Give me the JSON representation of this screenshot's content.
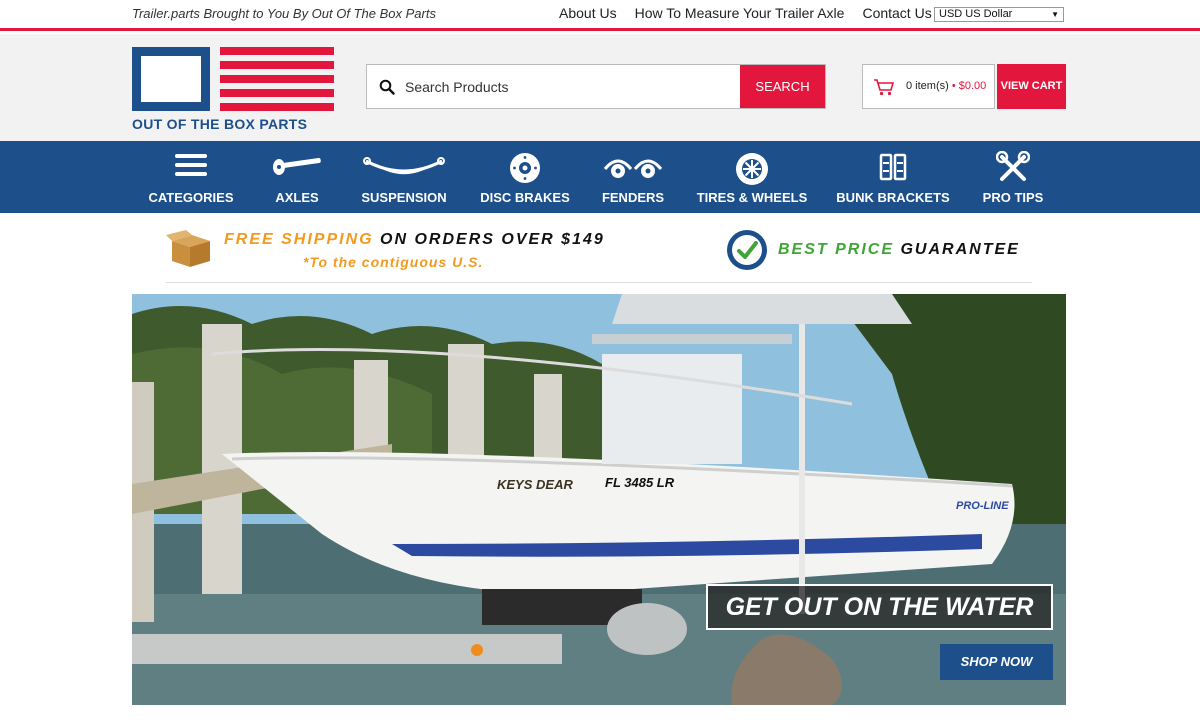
{
  "topbar": {
    "tagline": "Trailer.parts Brought to You By Out Of The Box Parts",
    "links": [
      "About Us",
      "How To Measure Your Trailer Axle",
      "Contact Us"
    ],
    "currency": "USD US Dollar"
  },
  "header": {
    "logo_text": "OUT OF THE BOX PARTS",
    "search_placeholder": "Search Products",
    "search_button": "SEARCH",
    "cart_count": "0 item(s)",
    "cart_sep": " • ",
    "cart_total": "$0.00",
    "view_cart": "VIEW CART"
  },
  "nav": {
    "items": [
      {
        "label": "CATEGORIES",
        "icon": "menu-icon"
      },
      {
        "label": "AXLES",
        "icon": "axle-icon"
      },
      {
        "label": "SUSPENSION",
        "icon": "leaf-spring-icon"
      },
      {
        "label": "DISC BRAKES",
        "icon": "disc-brake-icon"
      },
      {
        "label": "FENDERS",
        "icon": "fender-icon"
      },
      {
        "label": "TIRES & WHEELS",
        "icon": "wheel-icon"
      },
      {
        "label": "BUNK BRACKETS",
        "icon": "bracket-icon"
      },
      {
        "label": "PRO TIPS",
        "icon": "tools-icon"
      }
    ]
  },
  "promo": {
    "free_shipping": "FREE SHIPPING",
    "on_orders": "ON ORDERS OVER $149",
    "contiguous": "*To the contiguous U.S.",
    "best_price": "BEST PRICE",
    "guarantee": "GUARANTEE",
    "badge_text": "BEST PRICE GUARANTEE"
  },
  "hero": {
    "title": "GET OUT ON THE WATER",
    "button": "SHOP NOW",
    "boat_name": "KEYS DEAR",
    "registration": "FL 3485 LR",
    "brand": "PRO-LINE"
  },
  "colors": {
    "accent_red": "#e3173e",
    "brand_blue": "#1d4f8a",
    "promo_orange": "#f39a1e",
    "promo_green": "#3fa535"
  }
}
